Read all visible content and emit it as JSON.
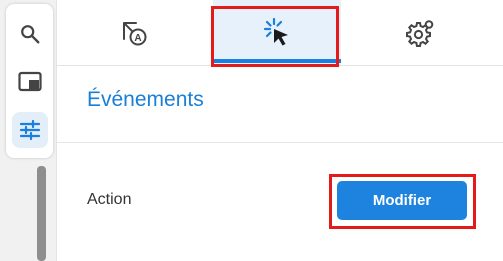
{
  "rail": {
    "items": [
      {
        "icon": "search-icon"
      },
      {
        "icon": "panel-icon"
      },
      {
        "icon": "sliders-icon",
        "active": true
      }
    ]
  },
  "tabs": [
    {
      "icon": "text-format-icon"
    },
    {
      "icon": "click-icon",
      "active": true
    },
    {
      "icon": "gear-icon"
    }
  ],
  "section": {
    "title": "Événements"
  },
  "action": {
    "label": "Action",
    "button_label": "Modifier"
  },
  "colors": {
    "accent": "#1d83de",
    "highlight": "#e41b1b",
    "active_tab_bg": "#e6f1fb"
  }
}
